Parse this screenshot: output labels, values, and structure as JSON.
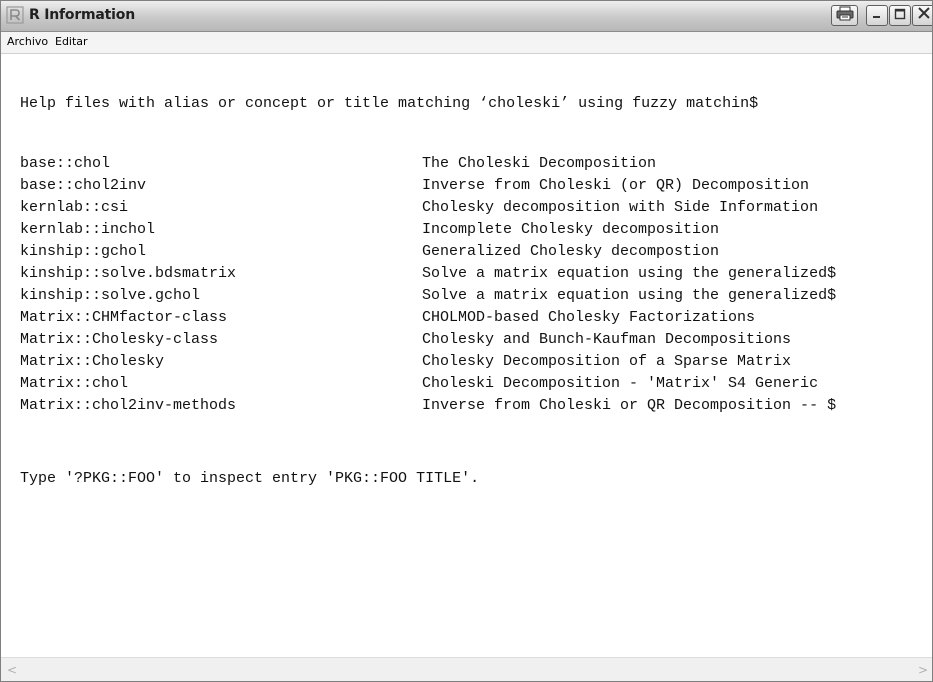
{
  "window": {
    "title": "R Information",
    "icons": {
      "app": "r-logo-icon",
      "print": "printer-icon",
      "minimize": "minimize-icon",
      "maximize": "maximize-icon",
      "close": "close-icon"
    }
  },
  "menu": {
    "items": [
      "Archivo",
      "Editar"
    ]
  },
  "content": {
    "header": "Help files with alias or concept or title matching ‘choleski’ using fuzzy matchin$",
    "entries": [
      {
        "name": "base::chol",
        "title": "The Choleski Decomposition"
      },
      {
        "name": "base::chol2inv",
        "title": "Inverse from Choleski (or QR) Decomposition"
      },
      {
        "name": "kernlab::csi",
        "title": "Cholesky decomposition with Side Information"
      },
      {
        "name": "kernlab::inchol",
        "title": "Incomplete Cholesky decomposition"
      },
      {
        "name": "kinship::gchol",
        "title": "Generalized Cholesky decompostion"
      },
      {
        "name": "kinship::solve.bdsmatrix",
        "title": "Solve a matrix equation using the generalized$"
      },
      {
        "name": "kinship::solve.gchol",
        "title": "Solve a matrix equation using the generalized$"
      },
      {
        "name": "Matrix::CHMfactor-class",
        "title": "CHOLMOD-based Cholesky Factorizations"
      },
      {
        "name": "Matrix::Cholesky-class",
        "title": "Cholesky and Bunch-Kaufman Decompositions"
      },
      {
        "name": "Matrix::Cholesky",
        "title": "Cholesky Decomposition of a Sparse Matrix"
      },
      {
        "name": "Matrix::chol",
        "title": "Choleski Decomposition - 'Matrix' S4 Generic"
      },
      {
        "name": "Matrix::chol2inv-methods",
        "title": "Inverse from Choleski or QR Decomposition -- $"
      }
    ],
    "footer": "Type '?PKG::FOO' to inspect entry 'PKG::FOO TITLE'."
  },
  "scrollbar": {
    "left_arrow": "<",
    "right_arrow": ">"
  }
}
